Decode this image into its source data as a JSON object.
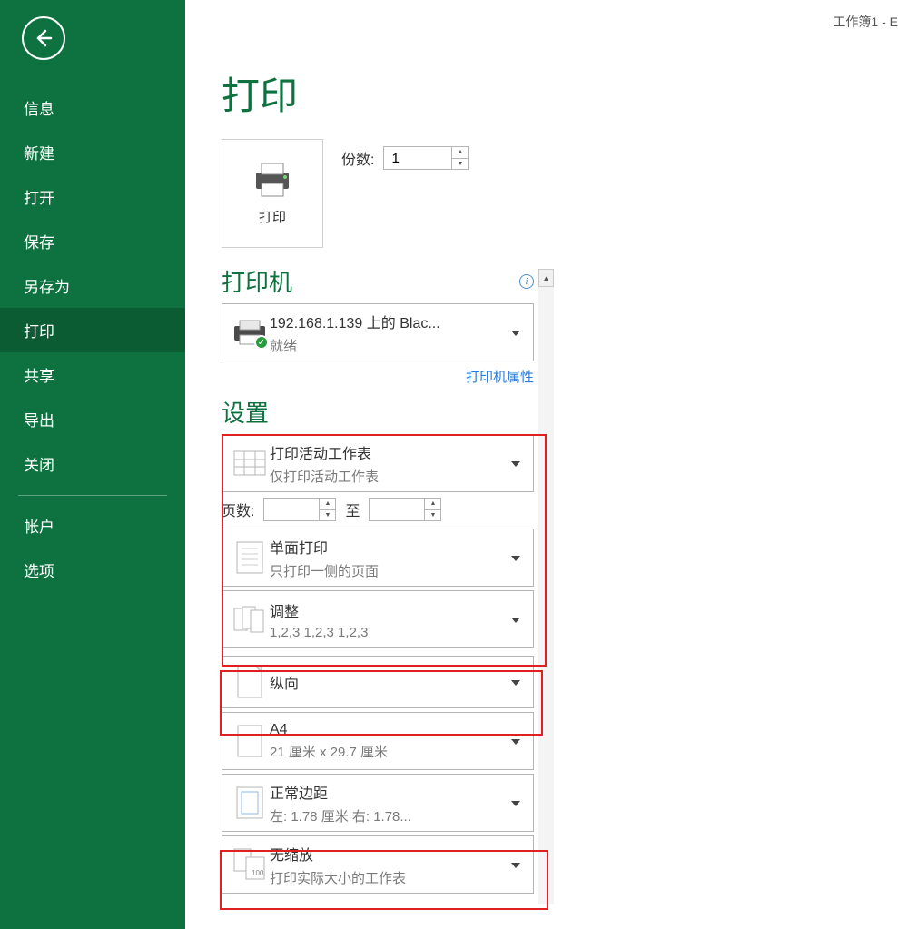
{
  "window_title": "工作簿1 - E",
  "sidebar": {
    "items": [
      "信息",
      "新建",
      "打开",
      "保存",
      "另存为",
      "打印",
      "共享",
      "导出",
      "关闭",
      "帐户",
      "选项"
    ],
    "active_index": 5
  },
  "page_title": "打印",
  "print_button_label": "打印",
  "copies": {
    "label": "份数:",
    "value": "1"
  },
  "printer_section": {
    "title": "打印机",
    "selected": {
      "name": "192.168.1.139 上的 Blac...",
      "status": "就绪"
    },
    "properties_link": "打印机属性"
  },
  "settings_section": {
    "title": "设置",
    "print_what": {
      "line1": "打印活动工作表",
      "line2": "仅打印活动工作表"
    },
    "pages": {
      "label": "页数:",
      "from": "",
      "to_label": "至",
      "to": ""
    },
    "sides": {
      "line1": "单面打印",
      "line2": "只打印一侧的页面"
    },
    "collation": {
      "line1": "调整",
      "line2": "1,2,3    1,2,3    1,2,3"
    },
    "orientation": {
      "line1": "纵向"
    },
    "paper": {
      "line1": "A4",
      "line2": "21 厘米 x 29.7 厘米"
    },
    "margins": {
      "line1": "正常边距",
      "line2": "左: 1.78 厘米   右: 1.78..."
    },
    "scaling": {
      "line1": "无缩放",
      "line2": "打印实际大小的工作表"
    }
  }
}
